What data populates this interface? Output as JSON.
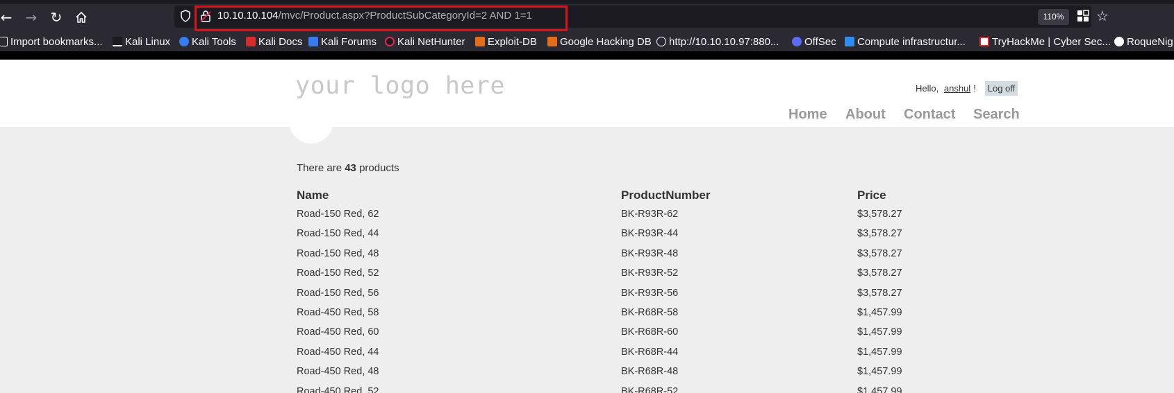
{
  "browser": {
    "url_host": "10.10.10.104",
    "url_path": "/mvc/Product.aspx?ProductSubCategoryId=2 AND 1=1",
    "zoom": "110%",
    "bookmarks": [
      "Import bookmarks...",
      "Kali Linux",
      "Kali Tools",
      "Kali Docs",
      "Kali Forums",
      "Kali NetHunter",
      "Exploit-DB",
      "Google Hacking DB",
      "http://10.10.10.97:880...",
      "OffSec",
      "Compute infrastructur...",
      "TryHackMe | Cyber Sec...",
      "RoqueNig"
    ]
  },
  "site": {
    "logo": "your logo here",
    "greeting": "Hello,",
    "username": "anshul",
    "exclaim": "!",
    "logoff": "Log off",
    "menu": [
      "Home",
      "About",
      "Contact",
      "Search"
    ]
  },
  "products": {
    "count_prefix": "There are",
    "count": "43",
    "count_suffix": "products",
    "columns": [
      "Name",
      "ProductNumber",
      "Price"
    ],
    "rows": [
      [
        "Road-150 Red, 62",
        "BK-R93R-62",
        "$3,578.27"
      ],
      [
        "Road-150 Red, 44",
        "BK-R93R-44",
        "$3,578.27"
      ],
      [
        "Road-150 Red, 48",
        "BK-R93R-48",
        "$3,578.27"
      ],
      [
        "Road-150 Red, 52",
        "BK-R93R-52",
        "$3,578.27"
      ],
      [
        "Road-150 Red, 56",
        "BK-R93R-56",
        "$3,578.27"
      ],
      [
        "Road-450 Red, 58",
        "BK-R68R-58",
        "$1,457.99"
      ],
      [
        "Road-450 Red, 60",
        "BK-R68R-60",
        "$1,457.99"
      ],
      [
        "Road-450 Red, 44",
        "BK-R68R-44",
        "$1,457.99"
      ],
      [
        "Road-450 Red, 48",
        "BK-R68R-48",
        "$1,457.99"
      ],
      [
        "Road-450 Red, 52",
        "BK-R68R-52",
        "$1,457.99"
      ]
    ]
  }
}
